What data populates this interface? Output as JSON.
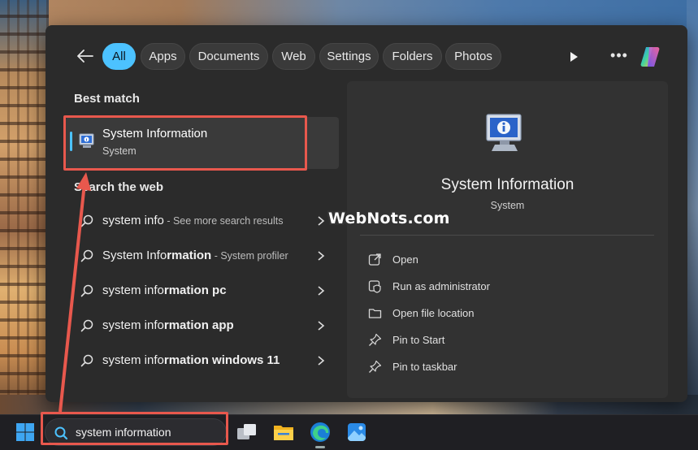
{
  "filters": {
    "items": [
      {
        "label": "All",
        "active": true
      },
      {
        "label": "Apps",
        "active": false
      },
      {
        "label": "Documents",
        "active": false
      },
      {
        "label": "Web",
        "active": false
      },
      {
        "label": "Settings",
        "active": false
      },
      {
        "label": "Folders",
        "active": false
      },
      {
        "label": "Photos",
        "active": false
      }
    ],
    "more_label": "•••"
  },
  "best_match": {
    "heading": "Best match",
    "title": "System Information",
    "subtitle": "System"
  },
  "search_web": {
    "heading": "Search the web",
    "rows": [
      {
        "prefix": "system info",
        "bold": "",
        "suffix": " - See more search results"
      },
      {
        "prefix": "System Info",
        "bold": "rmation",
        "suffix": " - System profiler"
      },
      {
        "prefix": "system info",
        "bold": "rmation pc",
        "suffix": ""
      },
      {
        "prefix": "system info",
        "bold": "rmation app",
        "suffix": ""
      },
      {
        "prefix": "system info",
        "bold": "rmation windows 11",
        "suffix": ""
      }
    ]
  },
  "preview": {
    "title": "System Information",
    "subtitle": "System",
    "actions": [
      {
        "label": "Open",
        "icon": "open-external-icon"
      },
      {
        "label": "Run as administrator",
        "icon": "shield-admin-icon"
      },
      {
        "label": "Open file location",
        "icon": "folder-icon"
      },
      {
        "label": "Pin to Start",
        "icon": "pin-icon"
      },
      {
        "label": "Pin to taskbar",
        "icon": "pin-icon"
      }
    ]
  },
  "watermark": "WebNots.com",
  "taskbar": {
    "search_value": "system information",
    "apps": [
      "task-view-icon",
      "file-explorer-icon",
      "edge-icon",
      "photos-icon"
    ]
  },
  "colors": {
    "accent": "#4cc2ff",
    "panel": "#2b2b2b",
    "annotation": "#e8584d"
  }
}
